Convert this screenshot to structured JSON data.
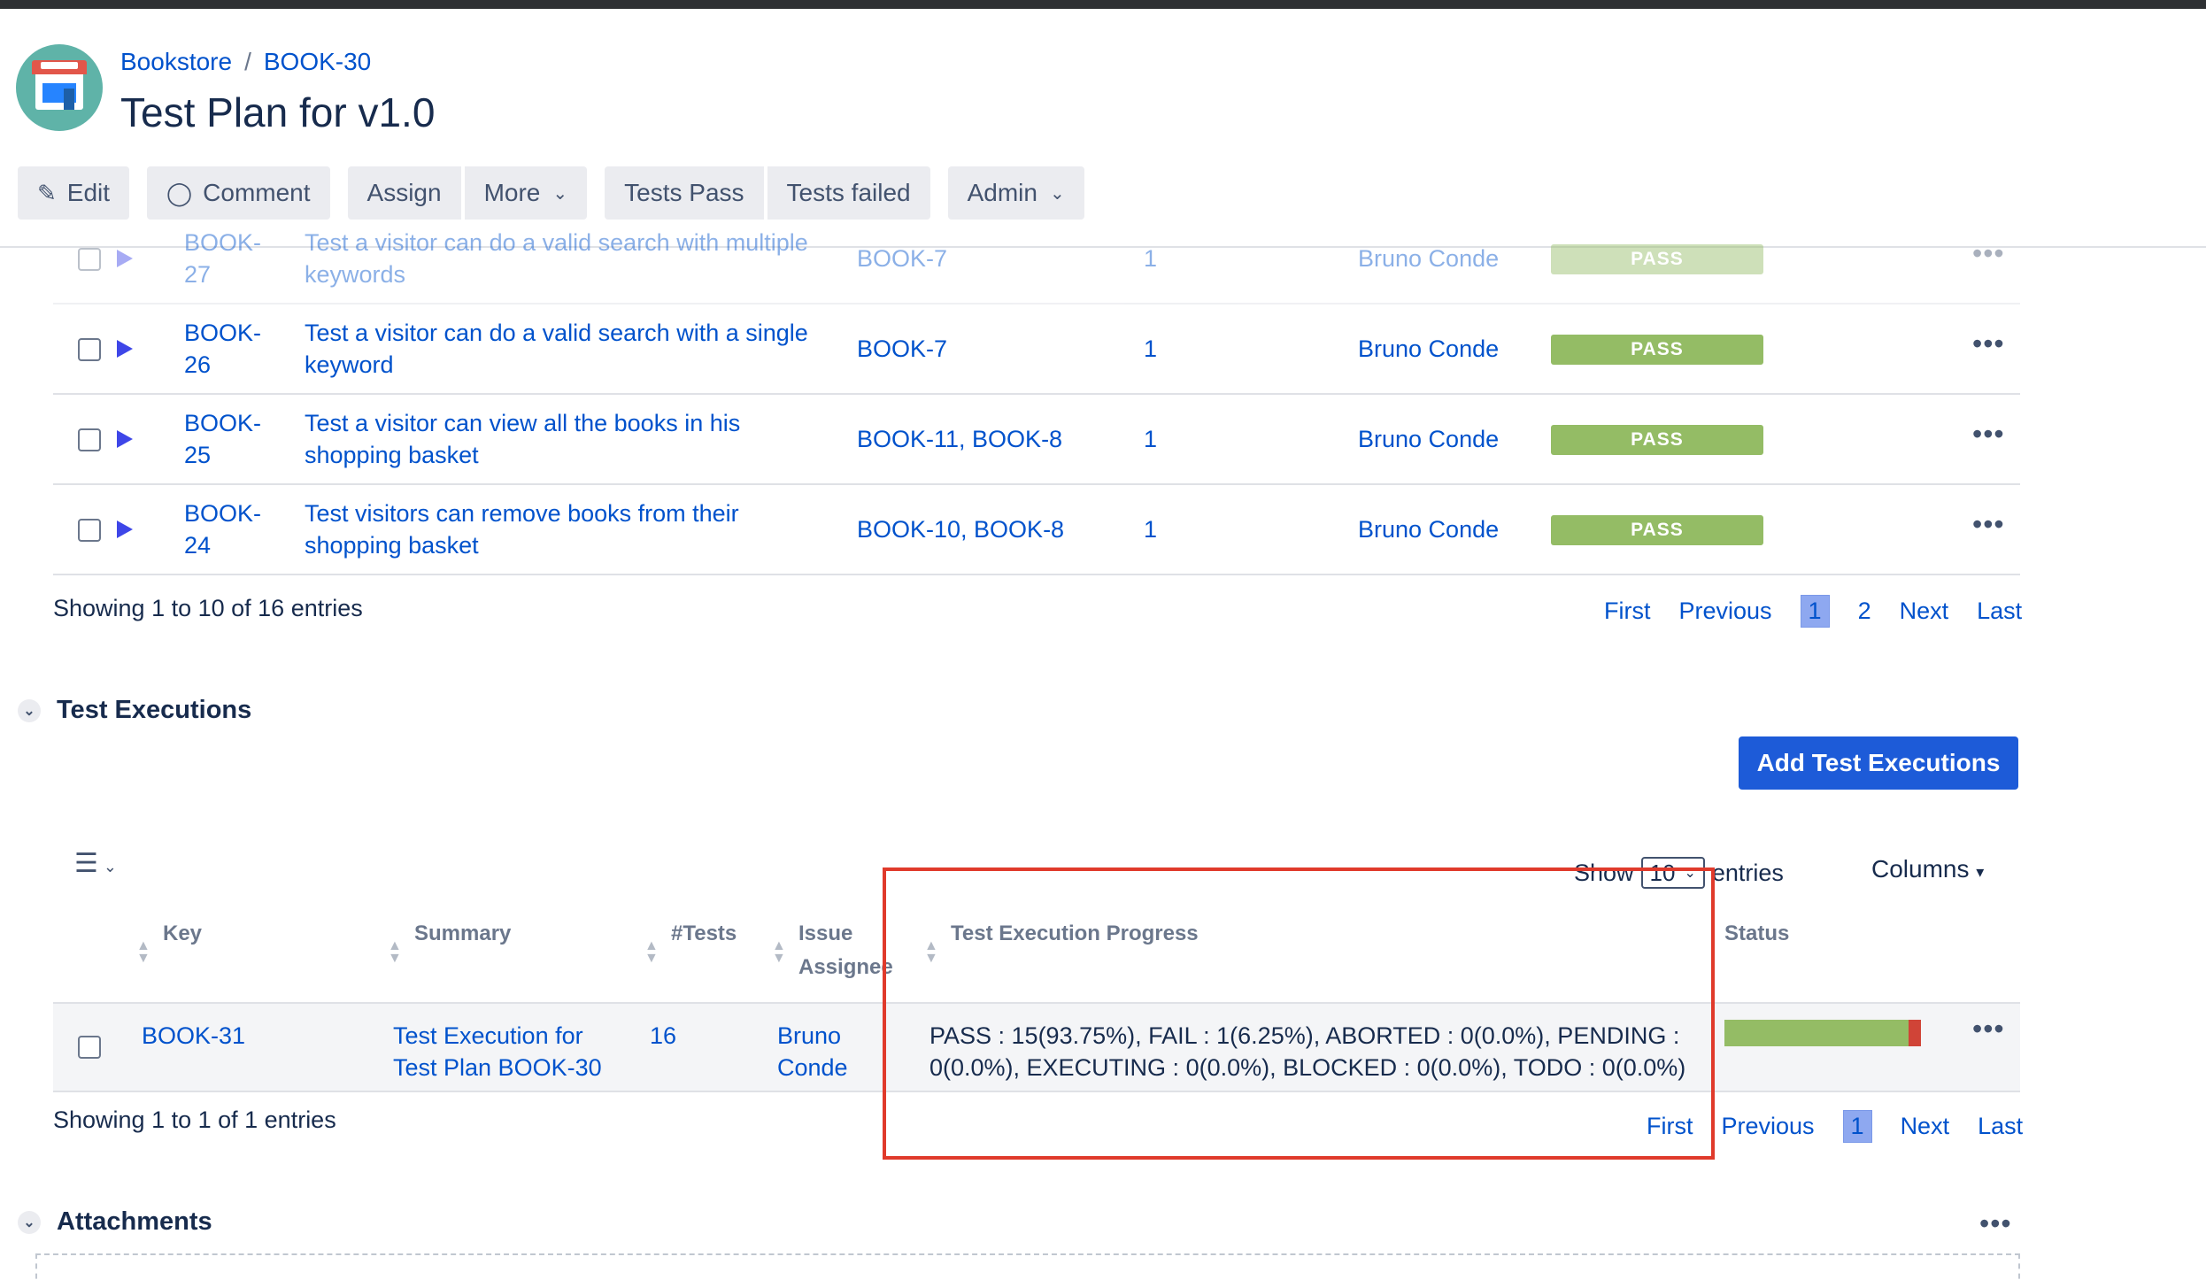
{
  "header": {
    "breadcrumb": [
      "Bookstore",
      "BOOK-30"
    ],
    "breadcrumb_sep": "/",
    "title": "Test Plan for v1.0"
  },
  "toolbar": {
    "edit": "Edit",
    "comment": "Comment",
    "assign": "Assign",
    "more": "More",
    "tests_pass": "Tests Pass",
    "tests_failed": "Tests failed",
    "admin": "Admin"
  },
  "tests": {
    "rows": [
      {
        "key1": "BOOK-",
        "key2": "27",
        "summary1": "Test a visitor can do a valid search with multiple",
        "summary2": "keywords",
        "reqs": "BOOK-7",
        "count": "1",
        "assignee": "Bruno Conde",
        "status": "PASS"
      },
      {
        "key1": "BOOK-",
        "key2": "26",
        "summary1": "Test a visitor can do a valid search with a single",
        "summary2": "keyword",
        "reqs": "BOOK-7",
        "count": "1",
        "assignee": "Bruno Conde",
        "status": "PASS"
      },
      {
        "key1": "BOOK-",
        "key2": "25",
        "summary1": "Test a visitor can view all the books in his",
        "summary2": "shopping basket",
        "reqs": "BOOK-11, BOOK-8",
        "count": "1",
        "assignee": "Bruno Conde",
        "status": "PASS"
      },
      {
        "key1": "BOOK-",
        "key2": "24",
        "summary1": "Test visitors can remove books from their",
        "summary2": "shopping basket",
        "reqs": "BOOK-10, BOOK-8",
        "count": "1",
        "assignee": "Bruno Conde",
        "status": "PASS"
      }
    ],
    "showing": "Showing 1 to 10 of 16 entries",
    "pager": {
      "first": "First",
      "previous": "Previous",
      "page1": "1",
      "page2": "2",
      "next": "Next",
      "last": "Last"
    }
  },
  "executions": {
    "section_title": "Test Executions",
    "add_button": "Add Test Executions",
    "show_label": "Show",
    "show_value": "10",
    "entries_label": "entries",
    "columns_label": "Columns",
    "headers": {
      "key": "Key",
      "summary": "Summary",
      "tests": "#Tests",
      "issue": "Issue",
      "assignee": "Assignee",
      "progress": "Test Execution Progress",
      "status": "Status"
    },
    "row": {
      "key": "BOOK-31",
      "summary1": "Test Execution for",
      "summary2": "Test Plan BOOK-30",
      "tests": "16",
      "assignee1": "Bruno",
      "assignee2": "Conde",
      "progress1": "PASS : 15(93.75%), FAIL : 1(6.25%), ABORTED : 0(0.0%), PENDING :",
      "progress2": "0(0.0%), EXECUTING : 0(0.0%), BLOCKED : 0(0.0%), TODO : 0(0.0%)",
      "pass_fraction": 0.9375,
      "fail_fraction": 0.0625
    },
    "showing": "Showing 1 to 1 of 1 entries",
    "pager": {
      "first": "First",
      "previous": "Previous",
      "page1": "1",
      "next": "Next",
      "last": "Last"
    }
  },
  "attachments": {
    "section_title": "Attachments"
  },
  "colors": {
    "pass": "#94bc65",
    "fail": "#d04437",
    "link": "#0052cc",
    "highlight": "#e03a2b",
    "primary_button": "#1d5bd8"
  }
}
